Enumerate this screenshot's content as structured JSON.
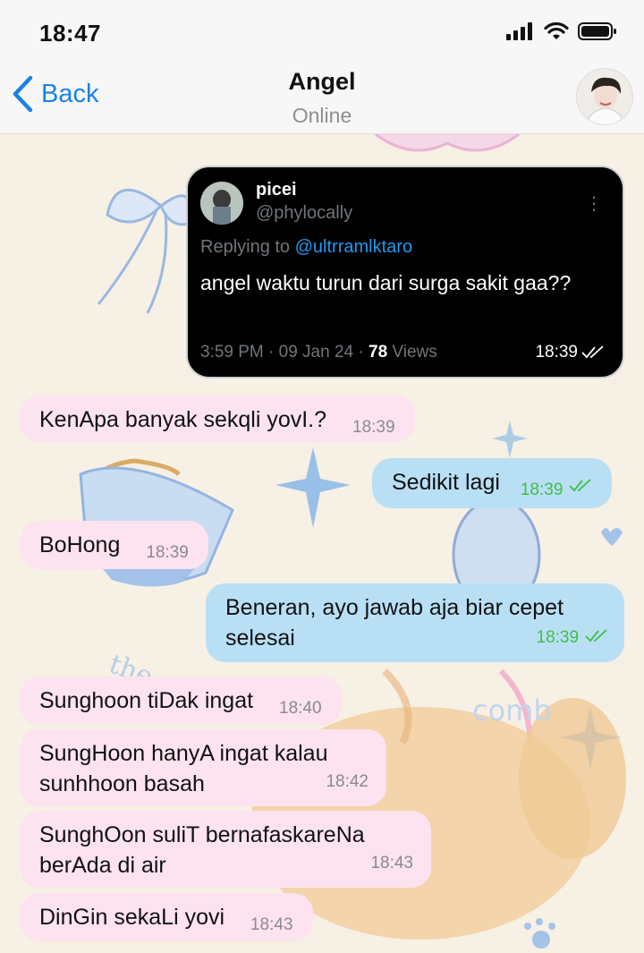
{
  "status_bar": {
    "time": "18:47"
  },
  "nav": {
    "back_label": "Back",
    "title": "Angel",
    "subtitle": "Online"
  },
  "tweet": {
    "name": "picei",
    "handle": "@phylocally",
    "replying_prefix": "Replying to ",
    "replying_to": "@ultrramlktaro",
    "text": "angel waktu turun dari surga sakit gaa??",
    "date_text": "3:59 PM · 09 Jan 24 · ",
    "views_count": "78",
    "views_label": " Views",
    "sent_time": "18:39"
  },
  "messages": [
    {
      "direction": "incoming",
      "text": "KenApa banyak sekqli yovI.?",
      "time": "18:39"
    },
    {
      "direction": "outgoing",
      "text": "Sedikit lagi",
      "time": "18:39"
    },
    {
      "direction": "incoming",
      "text": "BoHong",
      "time": "18:39"
    },
    {
      "direction": "outgoing",
      "line1": "Beneran, ayo jawab aja biar cepet",
      "line2": "selesai",
      "time": "18:39"
    },
    {
      "direction": "incoming",
      "text": "Sunghoon tiDak ingat",
      "time": "18:40"
    },
    {
      "direction": "incoming",
      "line1": "SungHoon hanyA ingat kalau",
      "line2": "sunhhoon basah",
      "time": "18:42"
    },
    {
      "direction": "incoming",
      "line1": "SunghOon suliT bernafaskareNa",
      "line2": "berAda di air",
      "time": "18:43"
    },
    {
      "direction": "incoming",
      "text": "DinGin sekaLi yovi",
      "time": "18:43"
    }
  ],
  "wallpaper_text": {
    "the": "the",
    "comb": "comb"
  },
  "colors": {
    "incoming_bubble": "#fde3ef",
    "outgoing_bubble": "#b9dff5",
    "read_check": "#3fbf44",
    "accent": "#1a82e6"
  }
}
